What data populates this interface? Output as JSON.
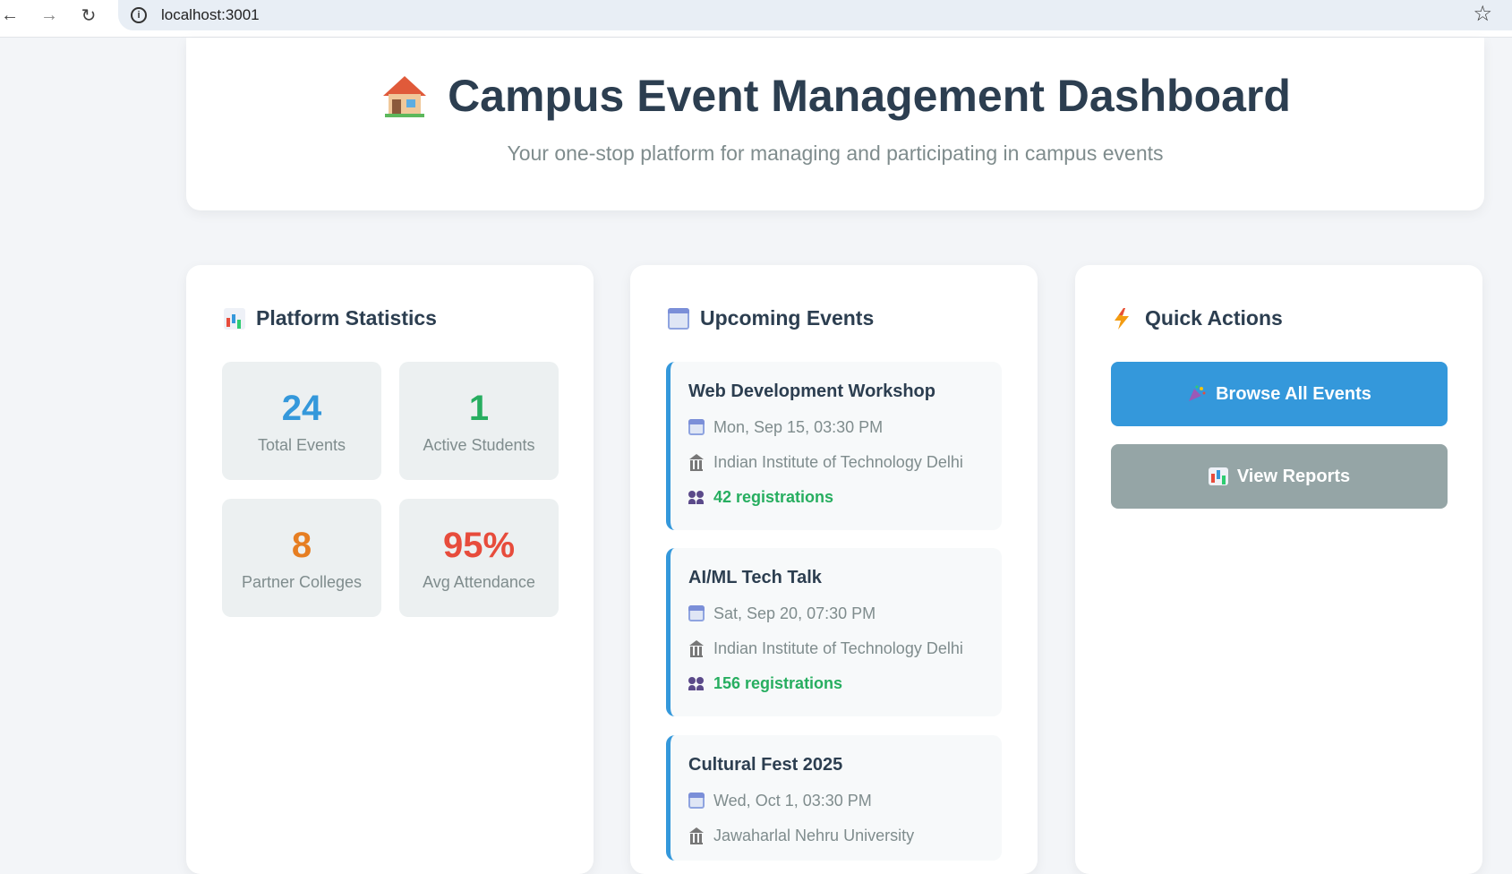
{
  "browser": {
    "url": "localhost:3001"
  },
  "header": {
    "title": "Campus Event Management Dashboard",
    "subtitle": "Your one-stop platform for managing and participating in campus events"
  },
  "stats": {
    "heading": "Platform Statistics",
    "items": [
      {
        "value": "24",
        "label": "Total Events",
        "color": "#3498db"
      },
      {
        "value": "1",
        "label": "Active Students",
        "color": "#27ae60"
      },
      {
        "value": "8",
        "label": "Partner Colleges",
        "color": "#e67e22"
      },
      {
        "value": "95%",
        "label": "Avg Attendance",
        "color": "#e74c3c"
      }
    ]
  },
  "events": {
    "heading": "Upcoming Events",
    "items": [
      {
        "title": "Web Development Workshop",
        "date": "Mon, Sep 15, 03:30 PM",
        "venue": "Indian Institute of Technology Delhi",
        "registrations": "42 registrations"
      },
      {
        "title": "AI/ML Tech Talk",
        "date": "Sat, Sep 20, 07:30 PM",
        "venue": "Indian Institute of Technology Delhi",
        "registrations": "156 registrations"
      },
      {
        "title": "Cultural Fest 2025",
        "date": "Wed, Oct 1, 03:30 PM",
        "venue": "Jawaharlal Nehru University"
      }
    ]
  },
  "actions": {
    "heading": "Quick Actions",
    "browse_label": "Browse All Events",
    "reports_label": "View Reports",
    "browse_color": "#3498db",
    "reports_color": "#95a5a6"
  }
}
